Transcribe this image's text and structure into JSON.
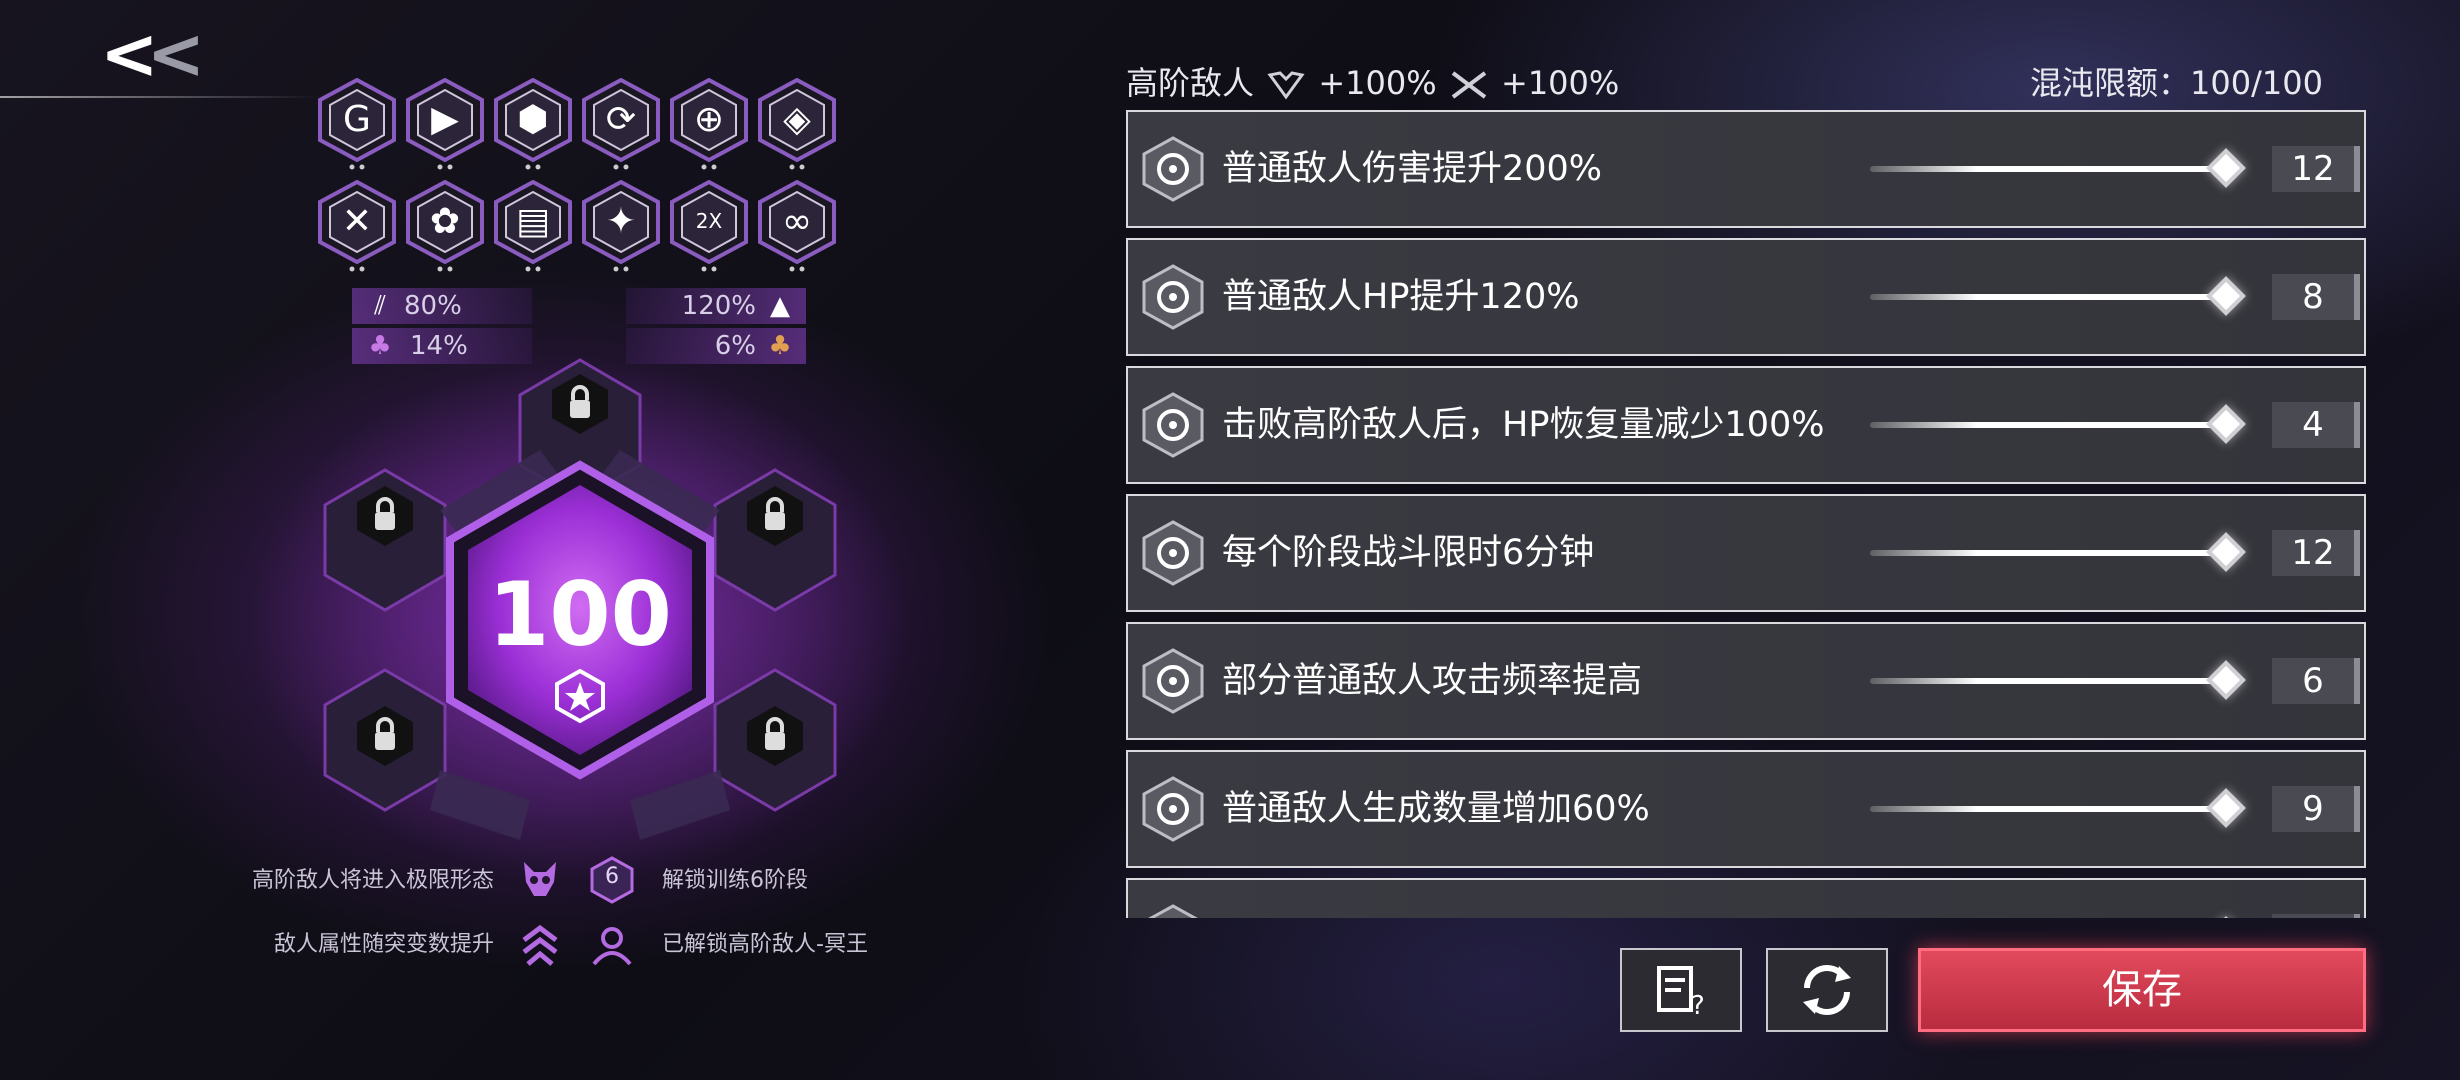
{
  "nav": {
    "back_label": "<<",
    "back_icon": "chevron-double-left-icon"
  },
  "mutators": {
    "row1_icons": [
      "crescent-gear-icon",
      "play-hex-icon",
      "cube-gear-icon",
      "cycle-plus-icon",
      "orbit-gear-icon",
      "chip-shield-icon"
    ],
    "row2_icons": [
      "crossed-swords-icon",
      "cog-cluster-icon",
      "document-stack-icon",
      "star-burst-icon",
      "2x-hex-icon",
      "infinity-loop-icon"
    ],
    "badge_2x": "2X"
  },
  "stats": {
    "left_top": {
      "value": "80%",
      "icon": "claw-icon"
    },
    "left_bottom": {
      "value": "14%",
      "icon": "trefoil-icon"
    },
    "right_top": {
      "value": "120%",
      "icon": "triangle-emblem-icon"
    },
    "right_bottom": {
      "value": "6%",
      "icon": "trefoil-orange-icon"
    }
  },
  "core": {
    "value": "100",
    "icon": "core-star-icon",
    "accent": "#a23ee0"
  },
  "info": {
    "line1_left": "高阶敌人将进入极限形态",
    "line1_right": "解锁训练6阶段",
    "badge_6": "6",
    "line2_left": "敌人属性随突变数提升",
    "line2_right": "已解锁高阶敌人-冥王"
  },
  "header": {
    "elite_label": "高阶敌人",
    "elite_hp_bonus": "+100%",
    "elite_atk_bonus": "+100%",
    "chaos_label": "混沌限额：",
    "chaos_value": "100/100"
  },
  "rows": [
    {
      "label": "普通敌人伤害提升200%",
      "value": "12",
      "icon": "lion-emblem-icon"
    },
    {
      "label": "普通敌人HP提升120%",
      "value": "8",
      "icon": "wolf-emblem-icon"
    },
    {
      "label": "击败高阶敌人后，HP恢复量减少100%",
      "value": "4",
      "icon": "wing-emblem-icon"
    },
    {
      "label": "每个阶段战斗限时6分钟",
      "value": "12",
      "icon": "hourglass-emblem-icon"
    },
    {
      "label": "部分普通敌人攻击频率提高",
      "value": "6",
      "icon": "beast-emblem-icon"
    },
    {
      "label": "普通敌人生成数量增加60%",
      "value": "9",
      "icon": "cross-shield-emblem-icon"
    },
    {
      "label": "",
      "value": "",
      "icon": "emblem-icon"
    }
  ],
  "buttons": {
    "notes_icon": "notes-help-icon",
    "reset_icon": "refresh-icon",
    "save_label": "保存"
  },
  "colors": {
    "accent_purple": "#a23ee0",
    "save_red": "#d23a4e"
  }
}
